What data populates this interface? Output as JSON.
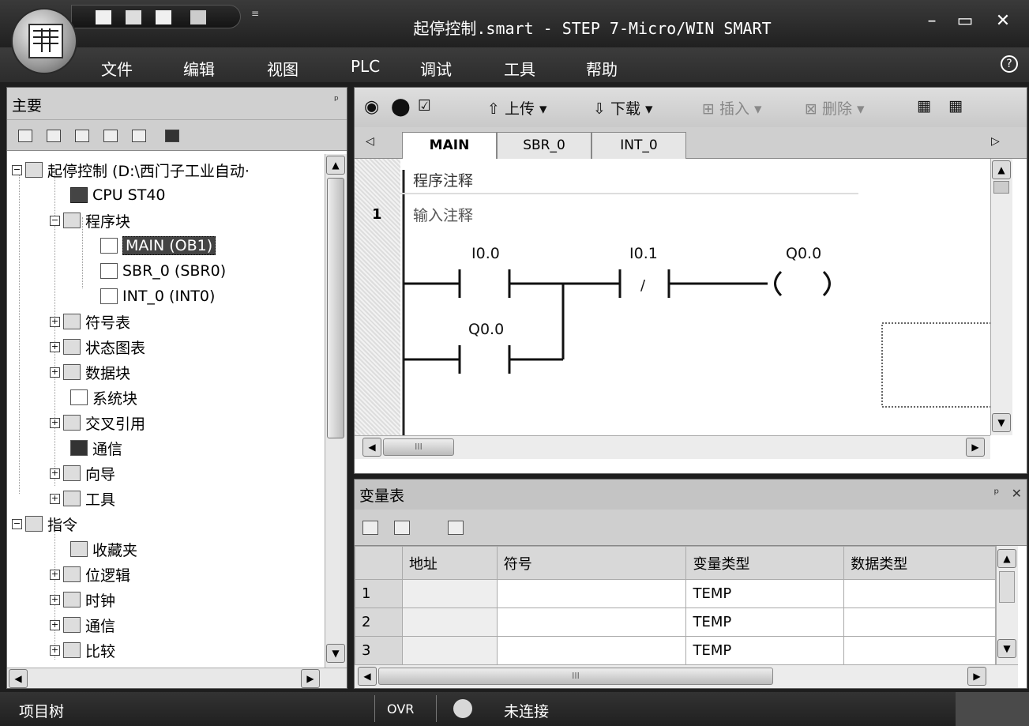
{
  "window": {
    "title": "起停控制.smart - STEP 7-Micro/WIN SMART",
    "minimize": "–",
    "maximize": "▭",
    "close": "✕",
    "qat_dropdown": "≡"
  },
  "menu": {
    "items": [
      "文件",
      "编辑",
      "视图",
      "PLC",
      "调试",
      "工具",
      "帮助"
    ],
    "help": "?"
  },
  "project_panel": {
    "title": "主要",
    "pin": "ᵖ",
    "tree": [
      {
        "label": "起停控制 (D:\\西门子工业自动·",
        "icon": "project-icon"
      },
      {
        "label": "CPU ST40",
        "icon": "cpu-icon"
      },
      {
        "label": "程序块",
        "icon": "program-block-icon"
      },
      {
        "label": "MAIN (OB1)",
        "icon": "ladder-icon"
      },
      {
        "label": "SBR_0 (SBR0)",
        "icon": "ladder-icon"
      },
      {
        "label": "INT_0 (INT0)",
        "icon": "ladder-icon"
      },
      {
        "label": "符号表",
        "icon": "symbol-table-icon"
      },
      {
        "label": "状态图表",
        "icon": "status-chart-icon"
      },
      {
        "label": "数据块",
        "icon": "data-block-icon"
      },
      {
        "label": "系统块",
        "icon": "system-block-icon"
      },
      {
        "label": "交叉引用",
        "icon": "cross-reference-icon"
      },
      {
        "label": "通信",
        "icon": "communication-icon"
      },
      {
        "label": "向导",
        "icon": "wizard-icon"
      },
      {
        "label": "工具",
        "icon": "tools-icon"
      },
      {
        "label": "指令",
        "icon": "instructions-icon"
      },
      {
        "label": "收藏夹",
        "icon": "favorites-icon"
      },
      {
        "label": "位逻辑",
        "icon": "bit-logic-icon"
      },
      {
        "label": "时钟",
        "icon": "clock-icon"
      },
      {
        "label": "通信",
        "icon": "comm-instruction-icon"
      },
      {
        "label": "比较",
        "icon": "compare-icon"
      }
    ]
  },
  "editor": {
    "toolbar": {
      "upload": "上传",
      "download": "下载",
      "insert": "插入",
      "delete": "删除"
    },
    "tabs": [
      "MAIN",
      "SBR_0",
      "INT_0"
    ],
    "program_comment": "程序注释",
    "rung_number": "1",
    "rung_comment": "输入注释",
    "contacts": {
      "start": "I0.0",
      "stop": "I0.1",
      "coil": "Q0.0",
      "seal": "Q0.0",
      "nc_slash": "/"
    },
    "hscroll_grip": "III"
  },
  "variable_table": {
    "title": "变量表",
    "pin": "ᵖ",
    "close": "✕",
    "columns": [
      "",
      "地址",
      "符号",
      "变量类型",
      "数据类型"
    ],
    "rows": [
      {
        "num": "1",
        "address": "",
        "symbol": "",
        "var_type": "TEMP",
        "data_type": ""
      },
      {
        "num": "2",
        "address": "",
        "symbol": "",
        "var_type": "TEMP",
        "data_type": ""
      },
      {
        "num": "3",
        "address": "",
        "symbol": "",
        "var_type": "TEMP",
        "data_type": ""
      }
    ],
    "hscroll_grip": "III"
  },
  "status_bar": {
    "project_tree": "项目树",
    "mode": "OVR",
    "connection": "未连接"
  }
}
